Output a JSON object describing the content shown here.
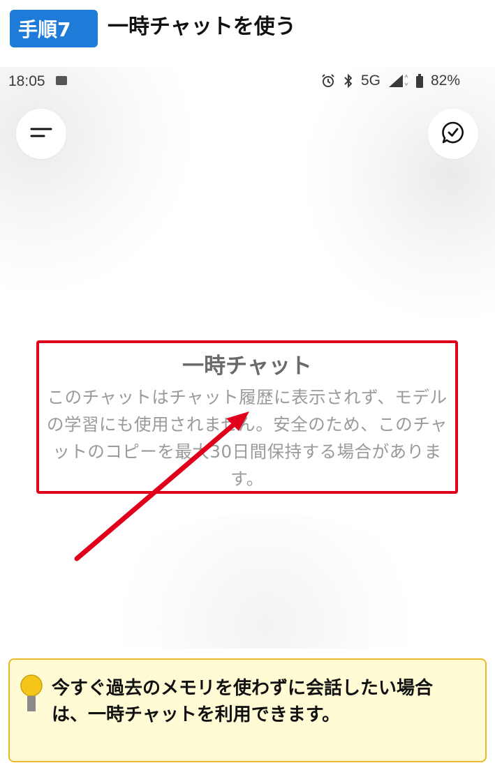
{
  "step": {
    "badge": "手順7",
    "title": "一時チャットを使う"
  },
  "statusbar": {
    "time": "18:05",
    "network": "5G",
    "battery": "82%"
  },
  "notice": {
    "title": "一時チャット",
    "body": "このチャットはチャット履歴に表示されず、モデルの学習にも使用されません。安全のため、このチャットのコピーを最大30日間保持する場合があります。"
  },
  "tip": {
    "text": "今すぐ過去のメモリを使わずに会話したい場合は、一時チャットを利用できます。"
  },
  "colors": {
    "badge": "#1e7bd8",
    "highlight": "#e0001b",
    "tip_bg": "#fffbd4",
    "tip_border": "#e8b928"
  }
}
